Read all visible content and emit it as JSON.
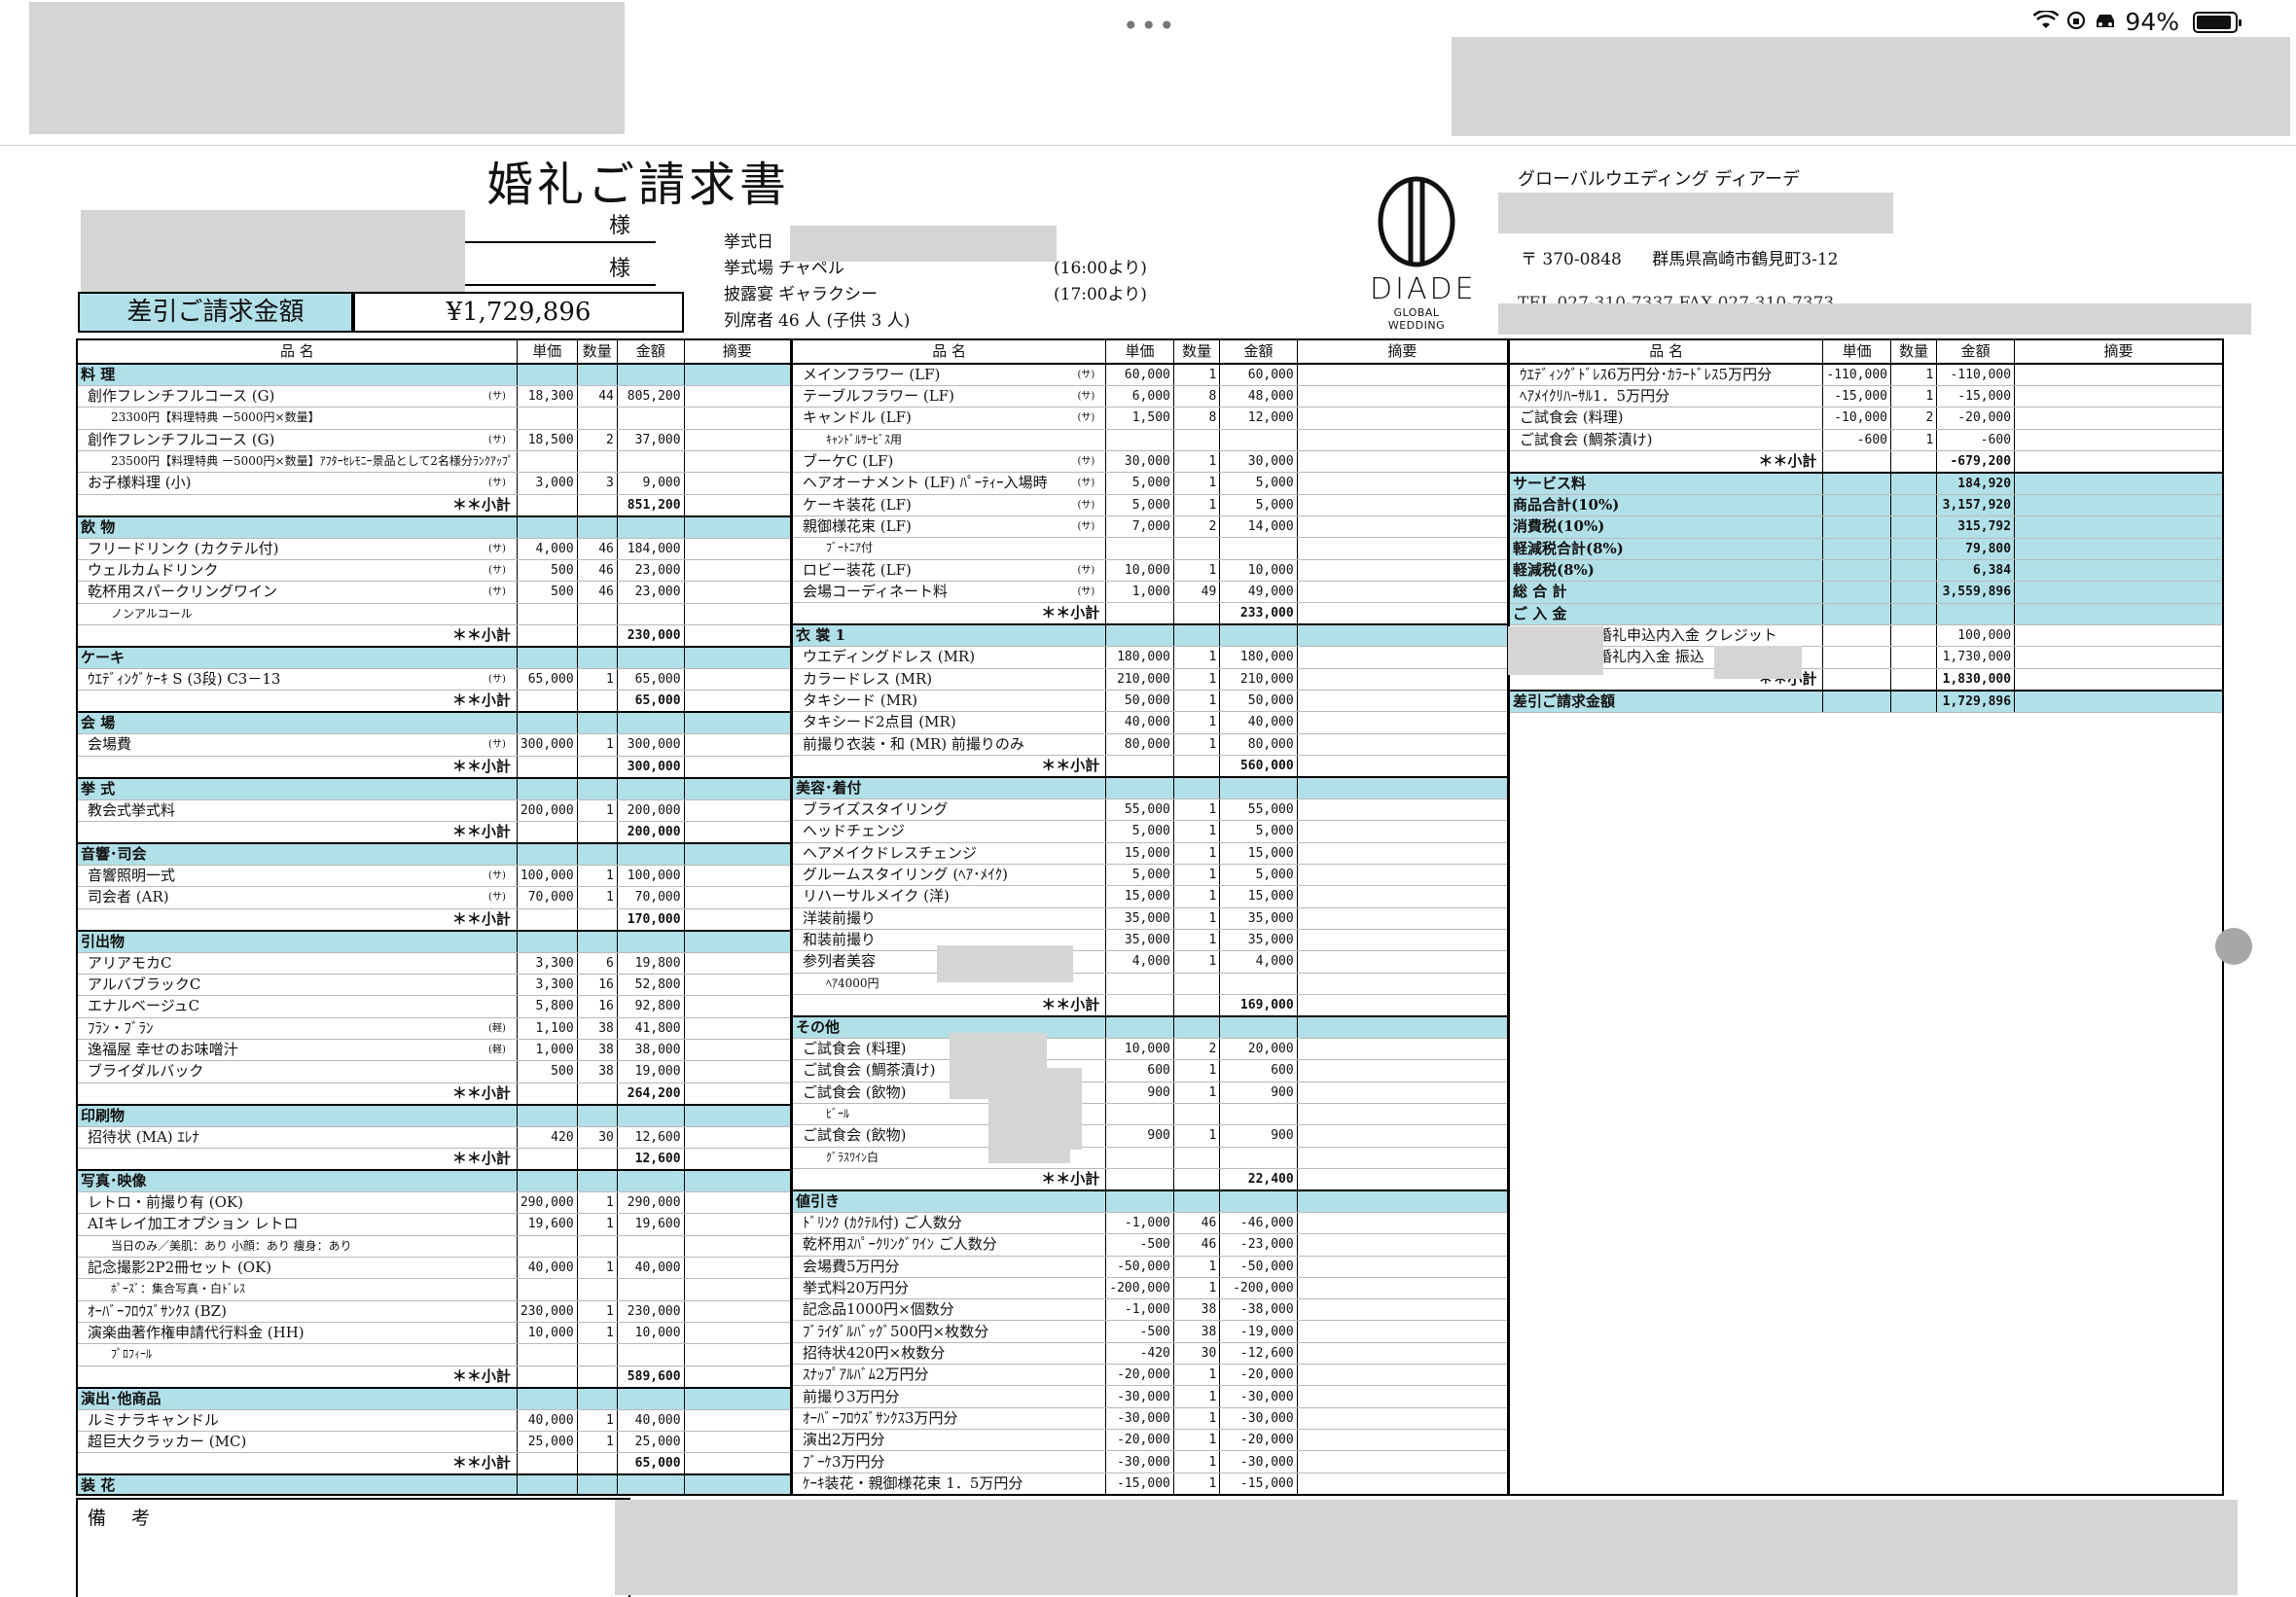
{
  "status": {
    "dots": "•••",
    "battery": "94%"
  },
  "title": "婚礼ご請求書",
  "sama": [
    "様",
    "様"
  ],
  "amount_label": "差引ご請求金額",
  "amount": "¥1,729,896",
  "info": [
    {
      "k": "挙式日",
      "v": "",
      "t": ""
    },
    {
      "k": "挙式場",
      "v": "チャペル",
      "t": "(16:00より)"
    },
    {
      "k": "披露宴",
      "v": "ギャラクシー",
      "t": "(17:00より)"
    },
    {
      "k": "列席者",
      "v": "46 人 (子供 3 人)",
      "t": ""
    }
  ],
  "logo": {
    "name": "DIADE",
    "sub": "GLOBAL WEDDING"
  },
  "company": "グローバルウエディング ディアーデ",
  "address": {
    "zip": "〒 370-0848",
    "addr": "群馬県高崎市鶴見町3-12"
  },
  "tel": "TEL 027-310-7337 FAX 027-310-7373",
  "headers": [
    "品 名",
    "単価",
    "数量",
    "金額",
    "摘要"
  ],
  "col1": [
    {
      "type": "sec",
      "name": "料 理"
    },
    {
      "name": "創作フレンチフルコース (G)",
      "tag": "(サ)",
      "price": "18,300",
      "qty": "44",
      "amount": "805,200"
    },
    {
      "type": "note",
      "name": "23300円【料理特典 ー5000円×数量】"
    },
    {
      "name": "創作フレンチフルコース (G)",
      "tag": "(サ)",
      "price": "18,500",
      "qty": "2",
      "amount": "37,000"
    },
    {
      "type": "note",
      "name": "23500円【料理特典 ー5000円×数量】ｱﾌﾀｰｾﾚﾓﾆｰ景品として2名様分ﾗﾝｸｱｯﾌﾟ"
    },
    {
      "name": "お子様料理 (小)",
      "tag": "(サ)",
      "price": "3,000",
      "qty": "3",
      "amount": "9,000"
    },
    {
      "type": "sub",
      "name": "＊＊小計",
      "amount": "851,200"
    },
    {
      "type": "sec",
      "name": "飲 物"
    },
    {
      "name": "フリードリンク (カクテル付)",
      "tag": "(サ)",
      "price": "4,000",
      "qty": "46",
      "amount": "184,000"
    },
    {
      "name": "ウェルカムドリンク",
      "tag": "(サ)",
      "price": "500",
      "qty": "46",
      "amount": "23,000"
    },
    {
      "name": "乾杯用スパークリングワイン",
      "tag": "(サ)",
      "price": "500",
      "qty": "46",
      "amount": "23,000"
    },
    {
      "type": "note",
      "name": "ノンアルコール"
    },
    {
      "type": "sub",
      "name": "＊＊小計",
      "amount": "230,000"
    },
    {
      "type": "sec",
      "name": "ケーキ"
    },
    {
      "name": "ｳｴﾃﾞｨﾝｸﾞｹｰｷ S (3段) C3－13",
      "tag": "(サ)",
      "price": "65,000",
      "qty": "1",
      "amount": "65,000"
    },
    {
      "type": "sub",
      "name": "＊＊小計",
      "amount": "65,000"
    },
    {
      "type": "sec",
      "name": "会 場"
    },
    {
      "name": "会場費",
      "tag": "(サ)",
      "price": "300,000",
      "qty": "1",
      "amount": "300,000"
    },
    {
      "type": "sub",
      "name": "＊＊小計",
      "amount": "300,000"
    },
    {
      "type": "sec",
      "name": "挙 式"
    },
    {
      "name": "教会式挙式料",
      "tag": "",
      "price": "200,000",
      "qty": "1",
      "amount": "200,000"
    },
    {
      "type": "sub",
      "name": "＊＊小計",
      "amount": "200,000"
    },
    {
      "type": "sec",
      "name": "音響･司会"
    },
    {
      "name": "音響照明一式",
      "tag": "(サ)",
      "price": "100,000",
      "qty": "1",
      "amount": "100,000"
    },
    {
      "name": "司会者 (AR)",
      "tag": "(サ)",
      "price": "70,000",
      "qty": "1",
      "amount": "70,000"
    },
    {
      "type": "sub",
      "name": "＊＊小計",
      "amount": "170,000"
    },
    {
      "type": "sec",
      "name": "引出物"
    },
    {
      "name": "アリアモカC",
      "tag": "",
      "price": "3,300",
      "qty": "6",
      "amount": "19,800"
    },
    {
      "name": "アルバブラックC",
      "tag": "",
      "price": "3,300",
      "qty": "16",
      "amount": "52,800"
    },
    {
      "name": "エナルベージュC",
      "tag": "",
      "price": "5,800",
      "qty": "16",
      "amount": "92,800"
    },
    {
      "name": "ﾌﾗﾝ・ﾌﾞﾗﾝ",
      "tag": "(軽)",
      "price": "1,100",
      "qty": "38",
      "amount": "41,800"
    },
    {
      "name": "逸福屋 幸せのお味噌汁",
      "tag": "(軽)",
      "price": "1,000",
      "qty": "38",
      "amount": "38,000"
    },
    {
      "name": "ブライダルバック",
      "tag": "",
      "price": "500",
      "qty": "38",
      "amount": "19,000"
    },
    {
      "type": "sub",
      "name": "＊＊小計",
      "amount": "264,200"
    },
    {
      "type": "sec",
      "name": "印刷物"
    },
    {
      "name": "招待状 (MA) ｴﾚﾅ",
      "tag": "",
      "price": "420",
      "qty": "30",
      "amount": "12,600"
    },
    {
      "type": "sub",
      "name": "＊＊小計",
      "amount": "12,600"
    },
    {
      "type": "sec",
      "name": "写真･映像"
    },
    {
      "name": "レトロ・前撮り有 (OK)",
      "tag": "",
      "price": "290,000",
      "qty": "1",
      "amount": "290,000"
    },
    {
      "name": "AIキレイ加工オプション レトロ",
      "tag": "",
      "price": "19,600",
      "qty": "1",
      "amount": "19,600"
    },
    {
      "type": "note",
      "name": "当日のみ／美肌：あり 小顔：あり 痩身：あり"
    },
    {
      "name": "記念撮影2P2冊セット (OK)",
      "tag": "",
      "price": "40,000",
      "qty": "1",
      "amount": "40,000"
    },
    {
      "type": "note",
      "name": "ﾎﾟｰｽﾞ：集合写真・白ﾄﾞﾚｽ"
    },
    {
      "name": "ｵｰﾊﾞｰﾌﾛｳｽﾞｻﾝｸｽ (BZ)",
      "tag": "",
      "price": "230,000",
      "qty": "1",
      "amount": "230,000"
    },
    {
      "name": "演楽曲著作権申請代行料金 (HH)",
      "tag": "",
      "price": "10,000",
      "qty": "1",
      "amount": "10,000"
    },
    {
      "type": "note",
      "name": "ﾌﾟﾛﾌｨｰﾙ"
    },
    {
      "type": "sub",
      "name": "＊＊小計",
      "amount": "589,600"
    },
    {
      "type": "sec",
      "name": "演出･他商品"
    },
    {
      "name": "ルミナラキャンドル",
      "tag": "",
      "price": "40,000",
      "qty": "1",
      "amount": "40,000"
    },
    {
      "name": "超巨大クラッカー (MC)",
      "tag": "",
      "price": "25,000",
      "qty": "1",
      "amount": "25,000"
    },
    {
      "type": "sub",
      "name": "＊＊小計",
      "amount": "65,000"
    },
    {
      "type": "sec",
      "name": "装 花"
    }
  ],
  "col2": [
    {
      "name": "メインフラワー (LF)",
      "tag": "(サ)",
      "price": "60,000",
      "qty": "1",
      "amount": "60,000"
    },
    {
      "name": "テーブルフラワー (LF)",
      "tag": "(サ)",
      "price": "6,000",
      "qty": "8",
      "amount": "48,000"
    },
    {
      "name": "キャンドル (LF)",
      "tag": "(サ)",
      "price": "1,500",
      "qty": "8",
      "amount": "12,000"
    },
    {
      "type": "note",
      "name": "ｷｬﾝﾄﾞﾙｻｰﾋﾞｽ用"
    },
    {
      "name": "ブーケC (LF)",
      "tag": "(サ)",
      "price": "30,000",
      "qty": "1",
      "amount": "30,000"
    },
    {
      "name": "ヘアオーナメント (LF) ﾊﾟｰﾃｨｰ入場時",
      "tag": "(サ)",
      "price": "5,000",
      "qty": "1",
      "amount": "5,000"
    },
    {
      "name": "ケーキ装花 (LF)",
      "tag": "(サ)",
      "price": "5,000",
      "qty": "1",
      "amount": "5,000"
    },
    {
      "name": "親御様花束 (LF)",
      "tag": "(サ)",
      "price": "7,000",
      "qty": "2",
      "amount": "14,000"
    },
    {
      "type": "note",
      "name": "ﾌﾞｰﾄﾆｱ付"
    },
    {
      "name": "ロビー装花 (LF)",
      "tag": "(サ)",
      "price": "10,000",
      "qty": "1",
      "amount": "10,000"
    },
    {
      "name": "会場コーディネート料",
      "tag": "(サ)",
      "price": "1,000",
      "qty": "49",
      "amount": "49,000"
    },
    {
      "type": "sub",
      "name": "＊＊小計",
      "amount": "233,000"
    },
    {
      "type": "sec",
      "name": "衣 裳 1"
    },
    {
      "name": "ウエディングドレス (MR)",
      "tag": "",
      "price": "180,000",
      "qty": "1",
      "amount": "180,000"
    },
    {
      "name": "カラードレス (MR)",
      "tag": "",
      "price": "210,000",
      "qty": "1",
      "amount": "210,000"
    },
    {
      "name": "タキシード (MR)",
      "tag": "",
      "price": "50,000",
      "qty": "1",
      "amount": "50,000"
    },
    {
      "name": "タキシード2点目 (MR)",
      "tag": "",
      "price": "40,000",
      "qty": "1",
      "amount": "40,000"
    },
    {
      "name": "前撮り衣装・和 (MR) 前撮りのみ",
      "tag": "",
      "price": "80,000",
      "qty": "1",
      "amount": "80,000"
    },
    {
      "type": "sub",
      "name": "＊＊小計",
      "amount": "560,000"
    },
    {
      "type": "sec",
      "name": "美容･着付"
    },
    {
      "name": "ブライズスタイリング",
      "tag": "",
      "price": "55,000",
      "qty": "1",
      "amount": "55,000"
    },
    {
      "name": "ヘッドチェンジ",
      "tag": "",
      "price": "5,000",
      "qty": "1",
      "amount": "5,000"
    },
    {
      "name": "ヘアメイクドレスチェンジ",
      "tag": "",
      "price": "15,000",
      "qty": "1",
      "amount": "15,000"
    },
    {
      "name": "グルームスタイリング (ﾍｱ･ﾒｲｸ)",
      "tag": "",
      "price": "5,000",
      "qty": "1",
      "amount": "5,000"
    },
    {
      "name": "リハーサルメイク (洋)",
      "tag": "",
      "price": "15,000",
      "qty": "1",
      "amount": "15,000"
    },
    {
      "name": "洋装前撮り",
      "tag": "",
      "price": "35,000",
      "qty": "1",
      "amount": "35,000"
    },
    {
      "name": "和装前撮り",
      "tag": "",
      "price": "35,000",
      "qty": "1",
      "amount": "35,000"
    },
    {
      "name": "参列者美容",
      "tag": "",
      "price": "4,000",
      "qty": "1",
      "amount": "4,000"
    },
    {
      "type": "note",
      "name": "ﾍｱ4000円"
    },
    {
      "type": "sub",
      "name": "＊＊小計",
      "amount": "169,000"
    },
    {
      "type": "sec",
      "name": "その他"
    },
    {
      "name": "ご試食会 (料理)",
      "tag": "",
      "price": "10,000",
      "qty": "2",
      "amount": "20,000"
    },
    {
      "name": "ご試食会 (鯛茶漬け)",
      "tag": "",
      "price": "600",
      "qty": "1",
      "amount": "600"
    },
    {
      "name": "ご試食会 (飲物)",
      "tag": "",
      "price": "900",
      "qty": "1",
      "amount": "900"
    },
    {
      "type": "note",
      "name": "ﾋﾞｰﾙ"
    },
    {
      "name": "ご試食会 (飲物)",
      "tag": "",
      "price": "900",
      "qty": "1",
      "amount": "900"
    },
    {
      "type": "note",
      "name": "ｸﾞﾗｽﾜｲﾝ白"
    },
    {
      "type": "sub",
      "name": "＊＊小計",
      "amount": "22,400"
    },
    {
      "type": "sec",
      "name": "値引き"
    },
    {
      "name": "ﾄﾞﾘﾝｸ (ｶｸﾃﾙ付) ご人数分",
      "tag": "",
      "price": "-1,000",
      "qty": "46",
      "amount": "-46,000"
    },
    {
      "name": "乾杯用ｽﾊﾟｰｸﾘﾝｸﾞﾜｲﾝ ご人数分",
      "tag": "",
      "price": "-500",
      "qty": "46",
      "amount": "-23,000"
    },
    {
      "name": "会場費5万円分",
      "tag": "",
      "price": "-50,000",
      "qty": "1",
      "amount": "-50,000"
    },
    {
      "name": "挙式料20万円分",
      "tag": "",
      "price": "-200,000",
      "qty": "1",
      "amount": "-200,000"
    },
    {
      "name": "記念品1000円×個数分",
      "tag": "",
      "price": "-1,000",
      "qty": "38",
      "amount": "-38,000"
    },
    {
      "name": "ﾌﾞﾗｲﾀﾞﾙﾊﾞｯｸﾞ500円×枚数分",
      "tag": "",
      "price": "-500",
      "qty": "38",
      "amount": "-19,000"
    },
    {
      "name": "招待状420円×枚数分",
      "tag": "",
      "price": "-420",
      "qty": "30",
      "amount": "-12,600"
    },
    {
      "name": "ｽﾅｯﾌﾟｱﾙﾊﾞﾑ2万円分",
      "tag": "",
      "price": "-20,000",
      "qty": "1",
      "amount": "-20,000"
    },
    {
      "name": "前撮り3万円分",
      "tag": "",
      "price": "-30,000",
      "qty": "1",
      "amount": "-30,000"
    },
    {
      "name": "ｵｰﾊﾞｰﾌﾛｳｽﾞｻﾝｸｽ3万円分",
      "tag": "",
      "price": "-30,000",
      "qty": "1",
      "amount": "-30,000"
    },
    {
      "name": "演出2万円分",
      "tag": "",
      "price": "-20,000",
      "qty": "1",
      "amount": "-20,000"
    },
    {
      "name": "ﾌﾞｰｹ3万円分",
      "tag": "",
      "price": "-30,000",
      "qty": "1",
      "amount": "-30,000"
    },
    {
      "name": "ｹｰｷ装花・親御様花束 1．5万円分",
      "tag": "",
      "price": "-15,000",
      "qty": "1",
      "amount": "-15,000"
    }
  ],
  "col3": [
    {
      "name": "ｳｴﾃﾞｨﾝｸﾞﾄﾞﾚｽ6万円分･ｶﾗｰﾄﾞﾚｽ5万円分",
      "tag": "",
      "price": "-110,000",
      "qty": "1",
      "amount": "-110,000"
    },
    {
      "name": "ﾍｱﾒｲｸﾘﾊｰｻﾙ1．5万円分",
      "tag": "",
      "price": "-15,000",
      "qty": "1",
      "amount": "-15,000"
    },
    {
      "name": "ご試食会 (料理)",
      "tag": "",
      "price": "-10,000",
      "qty": "2",
      "amount": "-20,000"
    },
    {
      "name": "ご試食会 (鯛茶漬け)",
      "tag": "",
      "price": "-600",
      "qty": "1",
      "amount": "-600"
    },
    {
      "type": "sub",
      "name": "＊＊小計",
      "amount": "-679,200"
    },
    {
      "type": "tot",
      "name": "サービス料",
      "amount": "184,920"
    },
    {
      "type": "tot",
      "name": "商品合計(10%)",
      "amount": "3,157,920"
    },
    {
      "type": "tot",
      "name": "消費税(10%)",
      "amount": "315,792"
    },
    {
      "type": "tot",
      "name": "軽減税合計(8%)",
      "amount": "79,800"
    },
    {
      "type": "tot",
      "name": "軽減税(8%)",
      "amount": "6,384"
    },
    {
      "type": "tot",
      "name": "総 合 計",
      "amount": "3,559,896"
    },
    {
      "type": "sec",
      "name": "ご 入 金"
    },
    {
      "name": "婚礼申込内入金 クレジット",
      "tag": "",
      "price": "",
      "qty": "",
      "amount": "100,000",
      "indent": true
    },
    {
      "name": "婚礼内入金 振込",
      "tag": "",
      "price": "",
      "qty": "",
      "amount": "1,730,000",
      "indent": true
    },
    {
      "type": "sub",
      "name": "＊＊小計",
      "amount": "1,830,000"
    },
    {
      "type": "tot",
      "name": "差引ご請求金額",
      "amount": "1,729,896"
    }
  ],
  "remarks": "備 考"
}
